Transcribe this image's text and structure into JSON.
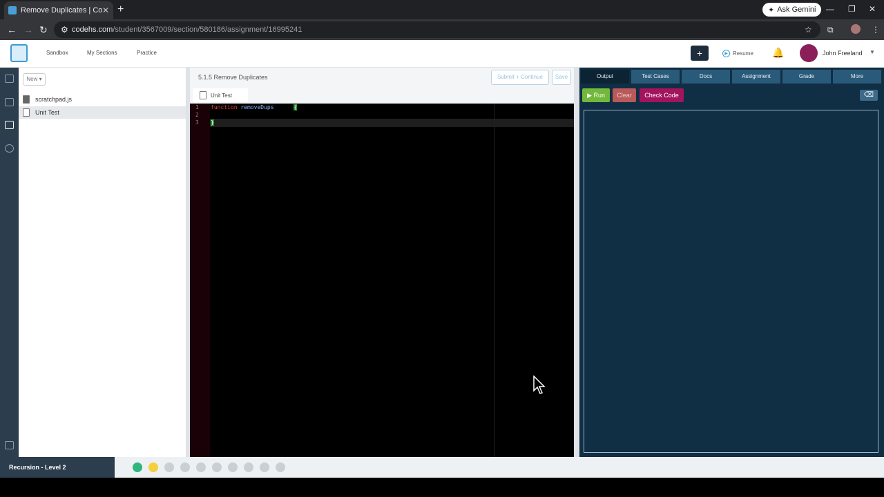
{
  "browser": {
    "tab_title": "Remove Duplicates | CodeHS",
    "tab_close": "✕",
    "new_tab": "+",
    "ask_gemini": "Ask Gemini",
    "url_domain": "codehs.com",
    "url_path": "/student/3567009/section/580186/assignment/16995241"
  },
  "header": {
    "nav": [
      "Sandbox",
      "My Sections",
      "Practice"
    ],
    "plus": "+",
    "resume": "Resume",
    "user_name": "John Freeland"
  },
  "files": {
    "new_label": "New",
    "items": [
      {
        "name": "scratchpad.js",
        "type": "js"
      },
      {
        "name": "Unit Test",
        "type": "doc",
        "active": true
      }
    ]
  },
  "editor": {
    "assignment_title": "5.1.5 Remove Duplicates",
    "submit_label": "Submit + Continue",
    "save_label": "Save",
    "tab_label": "Unit Test",
    "line_numbers": [
      "1",
      "2",
      "3"
    ]
  },
  "output": {
    "tabs": [
      "Output",
      "Test Cases",
      "Docs",
      "Assignment",
      "Grade",
      "More"
    ],
    "active_tab": "Output",
    "run_label": "Run",
    "clear_label": "Clear",
    "check_code_label": "Check Code"
  },
  "footer": {
    "level": "Recursion - Level 2",
    "progress_states": [
      "done",
      "current",
      "todo",
      "todo",
      "todo",
      "todo",
      "todo",
      "todo",
      "todo",
      "todo"
    ]
  },
  "colors": {
    "run": "#72b83a",
    "check_code": "#a3145f",
    "output_bg": "#102e44"
  }
}
